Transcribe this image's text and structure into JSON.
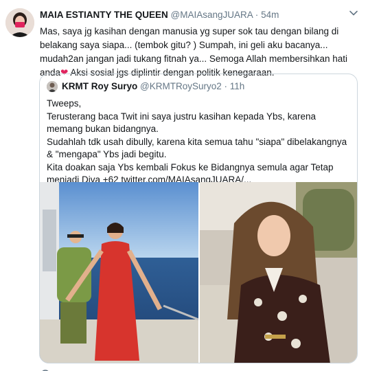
{
  "tweet": {
    "display_name": "MAIA ESTIANTY THE QUEEN",
    "handle": "@MAIAsangJUARA",
    "separator": "·",
    "time": "54m",
    "text_part1": "Mas, saya jg kasihan dengan manusia yg super sok tau dengan bilang di belakang saya siapa... (tembok gitu? ) Sumpah, ini geli aku bacanya... mudah2an jangan jadi tukang fitnah ya... Semoga Allah membersihkan hati anda",
    "heart": "❤",
    "text_part2": " Aksi sosial jgs diplintir dengan politik kenegaraan."
  },
  "quoted": {
    "display_name": "KRMT Roy Suryo",
    "handle": "@KRMTRoySuryo2",
    "separator": "·",
    "time": "11h",
    "lines": [
      "Tweeps,",
      "Terusterang baca Twit ini saya justru kasihan kepada Ybs, karena memang bukan bidangnya.",
      "Sudahlah tdk usah dibully, karena kita semua tahu \"siapa\" dibelakangnya & \"mengapa\" Ybs jadi begitu.",
      "Kita doakan saja Ybs kembali Fokus ke Bidangnya semula agar Tetap menjadi Diva +62 twitter.com/MAIAsangJUARA/..."
    ]
  },
  "icons": {
    "menu": "chevron-down-icon"
  }
}
